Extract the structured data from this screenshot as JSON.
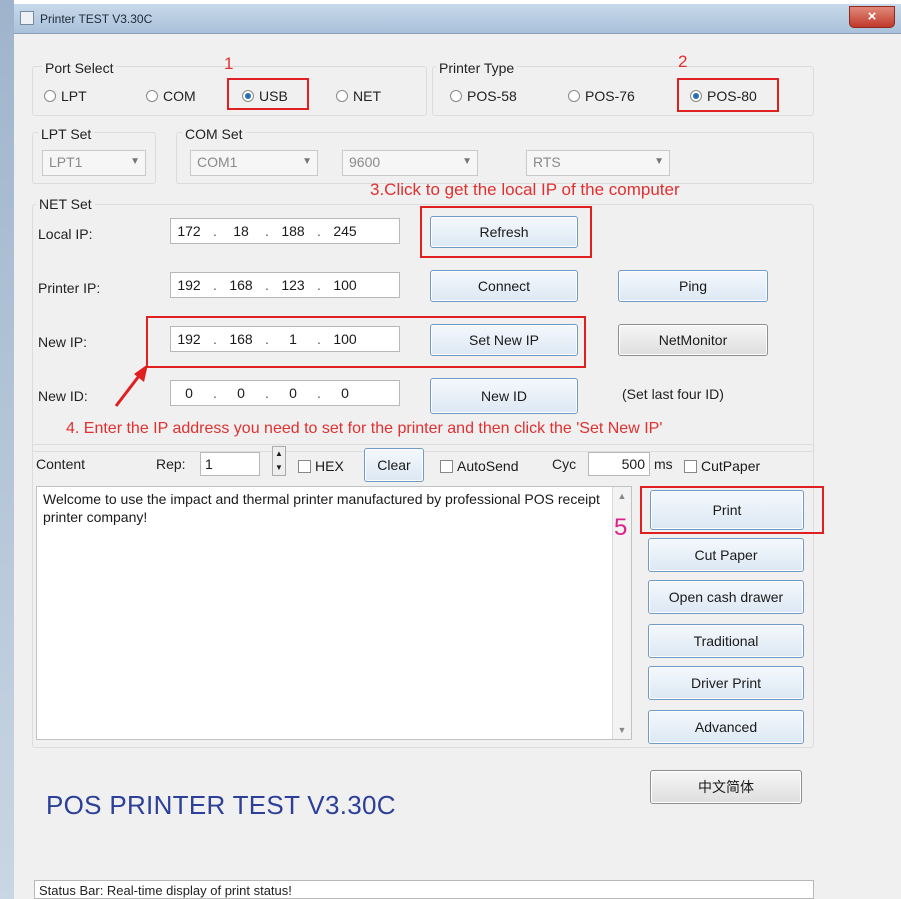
{
  "window": {
    "title": "Printer TEST V3.30C",
    "close_glyph": "×"
  },
  "port_select": {
    "label": "Port Select",
    "options": [
      {
        "label": "LPT",
        "selected": false
      },
      {
        "label": "COM",
        "selected": false
      },
      {
        "label": "USB",
        "selected": true
      },
      {
        "label": "NET",
        "selected": false
      }
    ],
    "annotation_number": "1"
  },
  "printer_type": {
    "label": "Printer Type",
    "options": [
      {
        "label": "POS-58",
        "selected": false
      },
      {
        "label": "POS-76",
        "selected": false
      },
      {
        "label": "POS-80",
        "selected": true
      }
    ],
    "annotation_number": "2"
  },
  "lpt_set": {
    "label": "LPT Set",
    "value": "LPT1"
  },
  "com_set": {
    "label": "COM Set",
    "port": "COM1",
    "baud": "9600",
    "flow": "RTS"
  },
  "net_set": {
    "label": "NET Set",
    "annotation_refresh": "3.Click to get the local IP of the computer",
    "local_ip": {
      "label": "Local IP:",
      "octets": [
        "172",
        "18",
        "188",
        "245"
      ]
    },
    "printer_ip": {
      "label": "Printer IP:",
      "octets": [
        "192",
        "168",
        "123",
        "100"
      ]
    },
    "new_ip": {
      "label": "New IP:",
      "octets": [
        "192",
        "168",
        "1",
        "100"
      ]
    },
    "new_id": {
      "label": "New ID:",
      "octets": [
        "0",
        "0",
        "0",
        "0"
      ]
    },
    "buttons": {
      "refresh": "Refresh",
      "connect": "Connect",
      "ping": "Ping",
      "set_new_ip": "Set New IP",
      "netmonitor": "NetMonitor",
      "new_id": "New ID"
    },
    "hint_last_four": "(Set last four ID)",
    "annotation_setip": "4. Enter the IP address you need to set for the printer and then click the 'Set New IP'"
  },
  "content": {
    "label": "Content",
    "rep_label": "Rep:",
    "rep_value": "1",
    "hex_label": "HEX",
    "clear_label": "Clear",
    "autosend_label": "AutoSend",
    "cyc_label": "Cyc",
    "cyc_value": "500",
    "ms_label": "ms",
    "cutpaper_label": "CutPaper",
    "text": "Welcome to use the impact and thermal printer manufactured by professional POS receipt printer company!"
  },
  "actions": {
    "print": "Print",
    "print_annotation": "5",
    "cut_paper": "Cut Paper",
    "open_cash_drawer": "Open cash drawer",
    "traditional": "Traditional",
    "driver_print": "Driver Print",
    "advanced": "Advanced",
    "language": "中文简体"
  },
  "brand_title": "POS PRINTER TEST V3.30C",
  "status_bar": "Status Bar: Real-time display of print status!",
  "colors": {
    "annotation_red": "#e02020",
    "brand_blue": "#2c3f99",
    "button_border": "#6f9ac6"
  }
}
